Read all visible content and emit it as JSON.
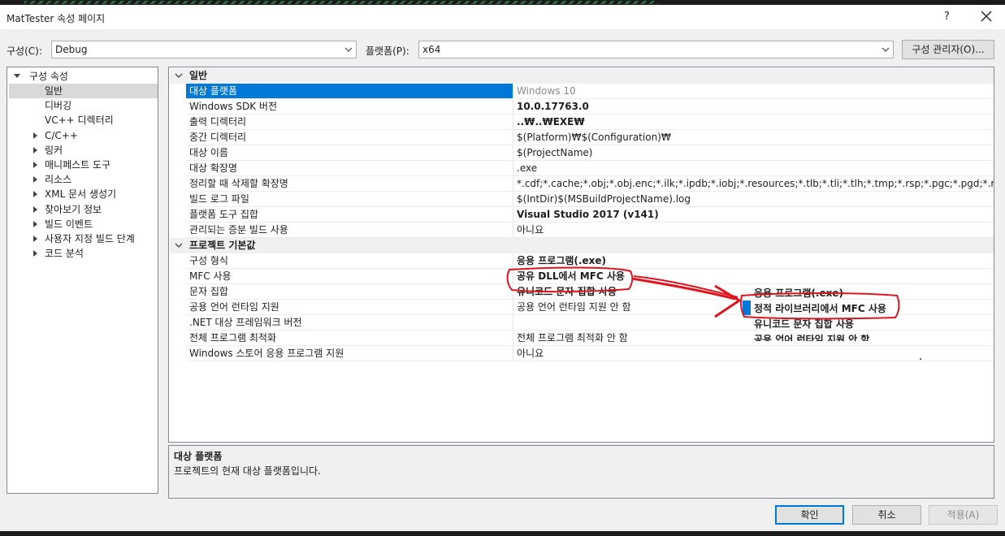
{
  "window": {
    "title": "MatTester 속성 페이지",
    "help_label": "?"
  },
  "toolbar": {
    "config_label": "구성(C):",
    "config_value": "Debug",
    "platform_label": "플랫폼(P):",
    "platform_value": "x64",
    "config_manager_label": "구성 관리자(O)..."
  },
  "tree": {
    "root": "구성 속성",
    "items": [
      {
        "label": "일반",
        "expandable": false,
        "selected": true
      },
      {
        "label": "디버깅",
        "expandable": false
      },
      {
        "label": "VC++ 디렉터리",
        "expandable": false
      },
      {
        "label": "C/C++",
        "expandable": true
      },
      {
        "label": "링커",
        "expandable": true
      },
      {
        "label": "매니페스트 도구",
        "expandable": true
      },
      {
        "label": "리소스",
        "expandable": true
      },
      {
        "label": "XML 문서 생성기",
        "expandable": true
      },
      {
        "label": "찾아보기 정보",
        "expandable": true
      },
      {
        "label": "빌드 이벤트",
        "expandable": true
      },
      {
        "label": "사용자 지정 빌드 단계",
        "expandable": true
      },
      {
        "label": "코드 분석",
        "expandable": true
      }
    ]
  },
  "grid": {
    "categories": [
      {
        "name": "일반",
        "rows": [
          {
            "name": "대상 플랫폼",
            "value": "Windows 10",
            "selected": true,
            "dim": true
          },
          {
            "name": "Windows SDK 버전",
            "value": "10.0.17763.0",
            "bold": true
          },
          {
            "name": "출력 디렉터리",
            "value": "..₩..₩EXE₩",
            "bold": true
          },
          {
            "name": "중간 디렉터리",
            "value": "$(Platform)₩$(Configuration)₩"
          },
          {
            "name": "대상 이름",
            "value": "$(ProjectName)"
          },
          {
            "name": "대상 확장명",
            "value": ".exe"
          },
          {
            "name": "정리할 때 삭제할 확장명",
            "value": "*.cdf;*.cache;*.obj;*.obj.enc;*.ilk;*.ipdb;*.iobj;*.resources;*.tlb;*.tli;*.tlh;*.tmp;*.rsp;*.pgc;*.pgd;*.meta;*.tlog;*.manifest;*.res;*.pch;*.exp;*.idb;*.rep;*.xdc;*.pdb;*_manifest.rc;*.bsc;*.sbr;*.xml;*.metagen;*.bi"
          },
          {
            "name": "빌드 로그 파일",
            "value": "$(IntDir)$(MSBuildProjectName).log"
          },
          {
            "name": "플랫폼 도구 집합",
            "value": "Visual Studio 2017 (v141)",
            "bold": true
          },
          {
            "name": "관리되는 증분 빌드 사용",
            "value": "아니요"
          }
        ]
      },
      {
        "name": "프로젝트 기본값",
        "rows": [
          {
            "name": "구성 형식",
            "value": "응용 프로그램(.exe)",
            "bold": true
          },
          {
            "name": "MFC 사용",
            "value": "공유 DLL에서 MFC 사용",
            "bold": true
          },
          {
            "name": "문자 집합",
            "value": "유니코드 문자 집합 사용",
            "bold": true
          },
          {
            "name": "공용 언어 런타임 지원",
            "value": "공용 언어 런타임 지원 안 함"
          },
          {
            "name": ".NET 대상 프레임워크 버전",
            "value": ""
          },
          {
            "name": "전체 프로그램 최적화",
            "value": "전체 프로그램 최적화 안 함"
          },
          {
            "name": "Windows 스토어 응용 프로그램 지원",
            "value": "아니요"
          }
        ]
      }
    ]
  },
  "dropdown_popup": {
    "options": [
      "응용 프로그램(.exe)",
      "정적 라이브러리에서 MFC 사용",
      "유니코드 문자 집합 사용",
      "공용 언어 런타임 지원 안 함"
    ],
    "highlighted": "정적 라이브러리에서 MFC 사용"
  },
  "description": {
    "heading": "대상 플랫폼",
    "text": "프로젝트의 현재 대상 플랫폼입니다."
  },
  "buttons": {
    "ok": "확인",
    "cancel": "취소",
    "apply": "적용(A)"
  },
  "colors": {
    "selection": "#0078d7",
    "annotation": "#e0141e"
  }
}
